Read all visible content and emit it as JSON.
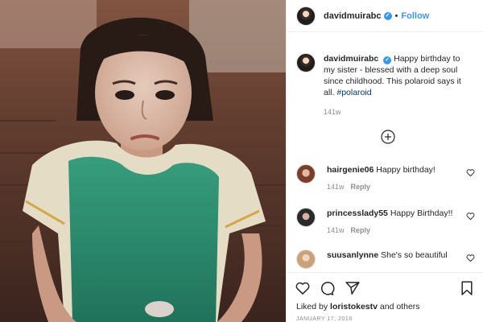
{
  "post": {
    "author": "davidmuirabc",
    "follow_label": "Follow",
    "separator": "•",
    "verified_glyph": "✓",
    "caption": "Happy birthday to my sister - blessed with a deep soul since childhood. This polaroid says it all.",
    "hashtag": "#polaroid",
    "caption_time": "141w"
  },
  "comments": [
    {
      "user": "hairgenie06",
      "text": "Happy birthday!",
      "time": "141w",
      "reply": "Reply"
    },
    {
      "user": "princesslady55",
      "text": "Happy Birthday!!",
      "time": "141w",
      "reply": "Reply"
    },
    {
      "user": "suusanlynne",
      "text": "She's so beautiful",
      "time": "",
      "reply": ""
    }
  ],
  "footer": {
    "liked_prefix": "Liked by",
    "liked_user": "loristokestv",
    "liked_suffix": "and others",
    "date": "JANUARY 17, 2018"
  },
  "icons": {
    "load_more": "plus-circle-icon",
    "like": "heart-icon",
    "comment": "comment-bubble-icon",
    "share": "paper-plane-icon",
    "save": "bookmark-icon",
    "comment_like": "small-heart-icon"
  },
  "colors": {
    "link_blue": "#3897f0",
    "hashtag": "#00376b",
    "muted": "#8e8e8e",
    "shirt_green": "#2f9a78"
  }
}
